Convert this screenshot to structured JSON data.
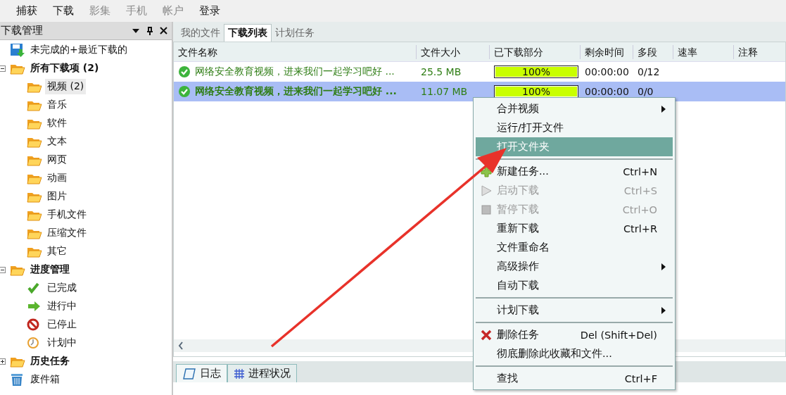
{
  "menu_bar": [
    {
      "label": "捕获",
      "disabled": false
    },
    {
      "label": "下载",
      "disabled": false
    },
    {
      "label": "影集",
      "disabled": true
    },
    {
      "label": "手机",
      "disabled": true
    },
    {
      "label": "帐户",
      "disabled": true
    },
    {
      "label": "登录",
      "disabled": false
    }
  ],
  "sidebar": {
    "title": "下载管理",
    "items": [
      {
        "label": "未完成的+最近下载的",
        "kind": "recent",
        "selected": false
      },
      {
        "label": "所有下载项 (2)",
        "kind": "folder",
        "selected": false,
        "expanded": true,
        "children": [
          {
            "label": "视频 (2)",
            "kind": "folder",
            "selected": true
          },
          {
            "label": "音乐",
            "kind": "folder",
            "selected": false
          },
          {
            "label": "软件",
            "kind": "folder",
            "selected": false
          },
          {
            "label": "文本",
            "kind": "folder",
            "selected": false
          },
          {
            "label": "网页",
            "kind": "folder",
            "selected": false
          },
          {
            "label": "动画",
            "kind": "folder",
            "selected": false
          },
          {
            "label": "图片",
            "kind": "folder",
            "selected": false
          },
          {
            "label": "手机文件",
            "kind": "folder",
            "selected": false
          },
          {
            "label": "压缩文件",
            "kind": "folder",
            "selected": false
          },
          {
            "label": "其它",
            "kind": "folder",
            "selected": false
          }
        ]
      },
      {
        "label": "进度管理",
        "kind": "folder",
        "selected": false,
        "expanded": true,
        "children": [
          {
            "label": "已完成",
            "kind": "done",
            "selected": false
          },
          {
            "label": "进行中",
            "kind": "running",
            "selected": false
          },
          {
            "label": "已停止",
            "kind": "stopped",
            "selected": false
          },
          {
            "label": "计划中",
            "kind": "scheduled",
            "selected": false
          }
        ]
      },
      {
        "label": "历史任务",
        "kind": "folder",
        "selected": false,
        "expanded": false
      },
      {
        "label": "废件箱",
        "kind": "trash",
        "selected": false
      }
    ]
  },
  "tabs": [
    {
      "label": "我的文件",
      "selected": false
    },
    {
      "label": "下载列表",
      "selected": true
    },
    {
      "label": "计划任务",
      "selected": false
    }
  ],
  "table": {
    "columns": [
      "文件名称",
      "文件大小",
      "已下载部分",
      "剩余时间",
      "多段",
      "速率",
      "注释"
    ],
    "rows": [
      {
        "name": "网络安全教育视频，进来我们一起学习吧好 ...",
        "size": "25.5 MB",
        "level": 1,
        "progress": "100%",
        "remaining": "00:00:00",
        "segments": "0/12",
        "selected": false
      },
      {
        "name": "网络安全教育视频，进来我们一起学习吧好 ...",
        "size": "11.07 MB",
        "level": 1,
        "progress": "100%",
        "remaining": "00:00:00",
        "segments": "0/0",
        "selected": true
      }
    ]
  },
  "bottom_tabs": [
    {
      "label": "日志",
      "kind": "log",
      "selected": true
    },
    {
      "label": "进程状况",
      "kind": "progress",
      "selected": false
    }
  ],
  "context_menu": [
    {
      "kind": "item",
      "label": "合并视频",
      "submenu": true,
      "disabled": false,
      "selected": false
    },
    {
      "kind": "item",
      "label": "运行/打开文件",
      "disabled": false,
      "selected": false
    },
    {
      "kind": "item",
      "label": "打开文件夹",
      "disabled": false,
      "selected": true
    },
    {
      "kind": "separator"
    },
    {
      "kind": "new",
      "label": "新建任务...",
      "shortcut": "Ctrl+N",
      "disabled": false,
      "selected": false
    },
    {
      "kind": "start",
      "label": "启动下载",
      "shortcut": "Ctrl+S",
      "disabled": true,
      "selected": false
    },
    {
      "kind": "pause",
      "label": "暂停下载",
      "shortcut": "Ctrl+O",
      "disabled": true,
      "selected": false
    },
    {
      "kind": "item",
      "label": "重新下载",
      "shortcut": "Ctrl+R",
      "disabled": false,
      "selected": false
    },
    {
      "kind": "item",
      "label": "文件重命名",
      "disabled": false,
      "selected": false
    },
    {
      "kind": "item",
      "label": "高级操作",
      "submenu": true,
      "disabled": false,
      "selected": false
    },
    {
      "kind": "item",
      "label": "自动下载",
      "disabled": false,
      "selected": false
    },
    {
      "kind": "separator"
    },
    {
      "kind": "item",
      "label": "计划下载",
      "submenu": true,
      "disabled": false,
      "selected": false
    },
    {
      "kind": "separator"
    },
    {
      "kind": "delete",
      "label": "删除任务",
      "shortcut": "Del (Shift+Del)",
      "disabled": false,
      "selected": false
    },
    {
      "kind": "item",
      "label": "彻底删除此收藏和文件...",
      "disabled": false,
      "selected": false
    },
    {
      "kind": "separator"
    },
    {
      "kind": "item",
      "label": "查找",
      "shortcut": "Ctrl+F",
      "disabled": false,
      "selected": false
    }
  ]
}
